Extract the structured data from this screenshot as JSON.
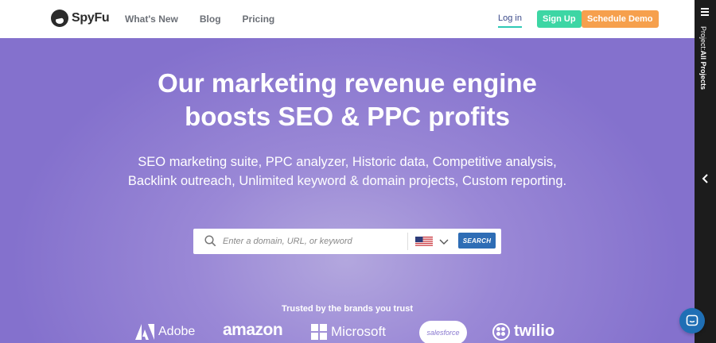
{
  "header": {
    "logo_text": "SpyFu",
    "nav": [
      "What's New",
      "Blog",
      "Pricing"
    ],
    "login": "Log in",
    "signup": "Sign Up",
    "demo": "Schedule Demo",
    "colors": {
      "signup": "#3dd6a4",
      "demo": "#f6a04d",
      "login_underline": "#2fc9b5"
    }
  },
  "hero": {
    "headline_line1": "Our marketing revenue engine",
    "headline_line2": "boosts SEO & PPC profits",
    "subhead": "SEO marketing suite, PPC analyzer, Historic data, Competitive analysis, Backlink outreach, Unlimited keyword & domain projects, Custom reporting.",
    "background": "#9a88d6"
  },
  "search": {
    "placeholder": "Enter a domain, URL, or keyword",
    "country_icon": "us-flag-icon",
    "button": "SEARCH",
    "button_color": "#2e6db5"
  },
  "trusted": {
    "label": "Trusted by the brands you trust",
    "brands": [
      "Adobe",
      "amazon",
      "Microsoft",
      "salesforce",
      "twilio"
    ]
  },
  "sidebar": {
    "label_prefix": "Project:",
    "label_value": "All Projects"
  }
}
